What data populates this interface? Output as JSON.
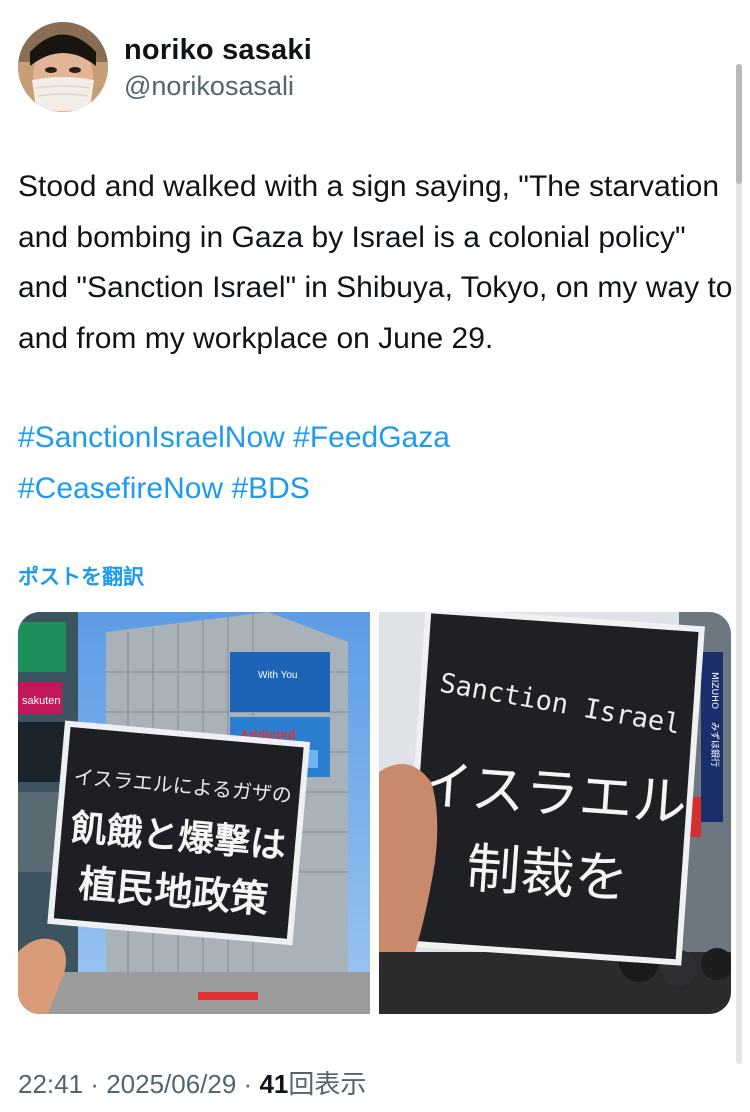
{
  "user": {
    "display_name": "noriko sasaki",
    "handle": "@norikosasali"
  },
  "tweet": {
    "text": "Stood and walked with a sign saying, \"The starvation and bombing in Gaza by Israel is a colonial policy\" and \"Sanction Israel\" in Shibuya, Tokyo, on my way to and from my workplace on June 29.",
    "hashtags": [
      "#SanctionIsraelNow",
      "#FeedGaza",
      "#CeasefireNow",
      "#BDS"
    ],
    "translate_label": "ポストを翻訳"
  },
  "photos": {
    "left": {
      "sign_lines": [
        "イスラエルによるガザの",
        "飢餓と爆撃は",
        "植民地政策"
      ],
      "building_text": "Addicted",
      "screen_text": "With You",
      "shop_text": "sakuten"
    },
    "right": {
      "sign_title": "Sanction Israel",
      "sign_lines": [
        "イスラエル",
        "制裁を"
      ],
      "bank_sign": "みずほ銀行",
      "bank_brand": "MIZUHO"
    }
  },
  "meta": {
    "time": "22:41",
    "separator1": " · ",
    "date": "2025/06/29",
    "separator2": " · ",
    "views": "41",
    "views_label": "回表示"
  }
}
